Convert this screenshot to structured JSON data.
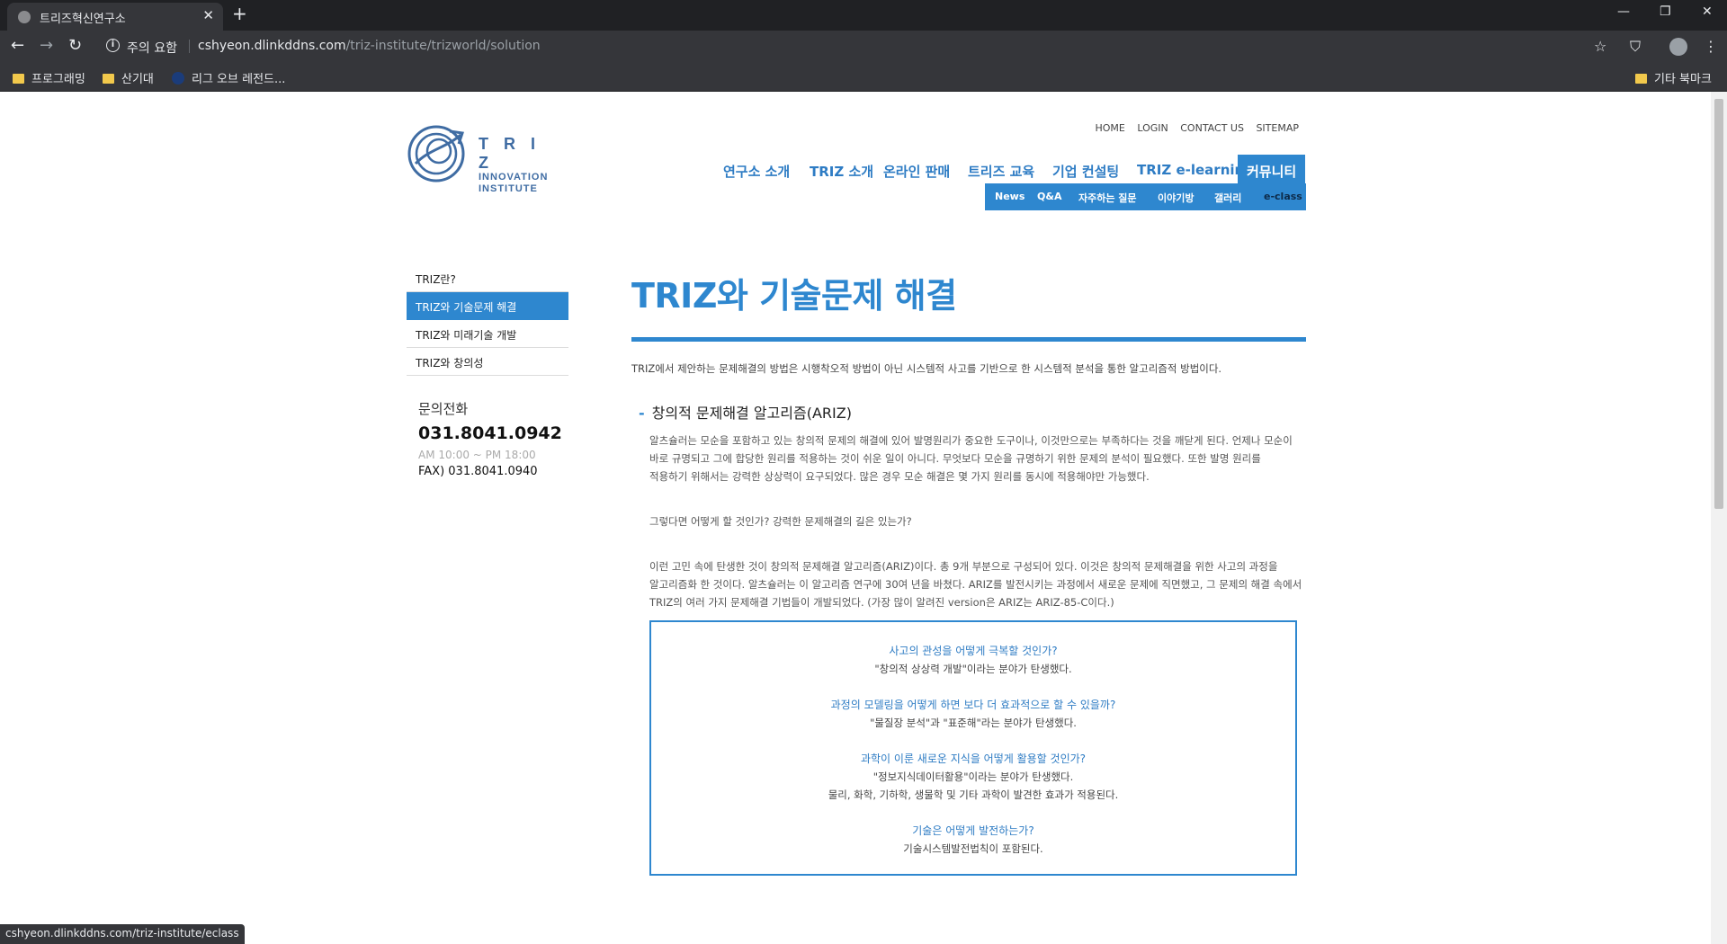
{
  "browser": {
    "tab_title": "트리즈혁신연구소",
    "tab_close": "✕",
    "new_tab": "+",
    "warning": "주의 요함",
    "url_host": "cshyeon.dlinkddns.com",
    "url_path": "/triz-institute/trizworld/solution",
    "bookmarks": [
      "프로그래밍",
      "산기대",
      "리그 오브 레전드..."
    ],
    "other_bookmarks": "기타 북마크",
    "status_url": "cshyeon.dlinkddns.com/triz-institute/eclass"
  },
  "logo": {
    "line1": "T R I Z",
    "line2": "INNOVATION",
    "line3": "INSTITUTE"
  },
  "util_links": [
    "HOME",
    "LOGIN",
    "CONTACT US",
    "SITEMAP"
  ],
  "gnb": [
    "연구소 소개",
    "TRIZ 소개",
    "온라인 판매",
    "트리즈 교육",
    "기업 컨설팅",
    "TRIZ e-learning",
    "커뮤니티"
  ],
  "subnav": [
    "News",
    "Q&A",
    "자주하는 질문",
    "이야기방",
    "갤러리",
    "e-class"
  ],
  "lnb": [
    "TRIZ란?",
    "TRIZ와 기술문제 해결",
    "TRIZ와 미래기술 개발",
    "TRIZ와 창의성"
  ],
  "contact": {
    "label": "문의전화",
    "phone": "031.8041.0942",
    "hours": "AM 10:00 ~ PM 18:00",
    "fax": "FAX) 031.8041.0940"
  },
  "content": {
    "title": "TRIZ와 기술문제 해결",
    "intro": "TRIZ에서 제안하는 문제해결의 방법은 시행착오적 방법이 아닌 시스템적 사고를 기반으로 한 시스템적 분석을 통한 알고리즘적 방법이다.",
    "section_title": "창의적 문제해결 알고리즘(ARIZ)",
    "para1": "알츠슐러는 모순을 포함하고 있는 창의적 문제의 해결에 있어 발명원리가 중요한 도구이나, 이것만으로는 부족하다는 것을 깨닫게 된다. 언제나 모순이 바로 규명되고 그에 합당한 원리를 적용하는 것이 쉬운 일이 아니다. 무엇보다 모순을 규명하기 위한 문제의 분석이 필요했다. 또한 발명 원리를 적용하기 위해서는 강력한 상상력이 요구되었다. 많은 경우 모순 해결은 몇 가지 원리를 동시에 적용해야만 가능했다.",
    "para2": "그렇다면 어떻게 할 것인가? 강력한 문제해결의 길은 있는가?",
    "para3": "이런 고민 속에 탄생한 것이 창의적 문제해결 알고리즘(ARIZ)이다. 총 9개 부분으로 구성되어 있다. 이것은 창의적 문제해결을 위한 사고의 과정을 알고리즘화 한 것이다. 알츠슐러는 이 알고리즘 연구에 30여 년을 바쳤다. ARIZ를 발전시키는 과정에서 새로운 문제에 직면했고, 그 문제의 해결 속에서 TRIZ의 여러 가지 문제해결 기법들이 개발되었다. (가장 많이 알려진 version은 ARIZ는 ARIZ-85-C이다.)",
    "box": [
      {
        "q": "사고의 관성을 어떻게 극복할 것인가?",
        "a": [
          "\"창의적 상상력 개발\"이라는 분야가 탄생했다."
        ]
      },
      {
        "q": "과정의 모델링을 어떻게 하면 보다 더 효과적으로 할 수 있을까?",
        "a": [
          "\"물질장 분석\"과 \"표준해\"라는 분야가 탄생했다."
        ]
      },
      {
        "q": "과학이 이룬 새로운 지식을 어떻게 활용할 것인가?",
        "a": [
          "\"정보지식데이터활용\"이라는 분야가 탄생했다.",
          "물리, 화학, 기하학, 생물학 및 기타 과학이 발견한 효과가 적용된다."
        ]
      },
      {
        "q": "기술은 어떻게 발전하는가?",
        "a": [
          "기술시스템발전법칙이 포함된다."
        ]
      }
    ]
  },
  "colors": {
    "accent": "#2e87cf",
    "chrome_dark": "#202124",
    "chrome": "#35363a"
  }
}
